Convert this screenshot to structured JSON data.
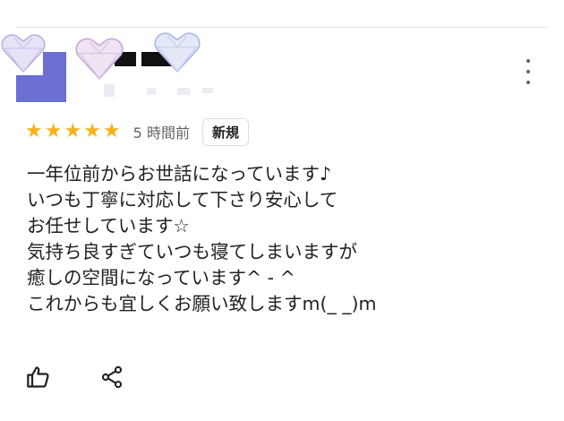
{
  "review": {
    "rating": 5,
    "rating_max": 5,
    "time": "5 時間前",
    "badge": "新規",
    "lines": [
      "一年位前からお世話になっています♪",
      "いつも丁寧に対応して下さり安心して",
      "お任せしています☆",
      "気持ち良すぎていつも寝てしまいますが",
      "癒しの空間になっています^ - ^",
      "これからも宜しくお願い致しますm(_ _)m"
    ]
  },
  "colors": {
    "star": "#f7b21a",
    "avatar": "#6a6fd1",
    "icon": "#202124"
  },
  "icons": {
    "more": "more-vert-icon",
    "like": "thumb-up-icon",
    "share": "share-icon"
  }
}
